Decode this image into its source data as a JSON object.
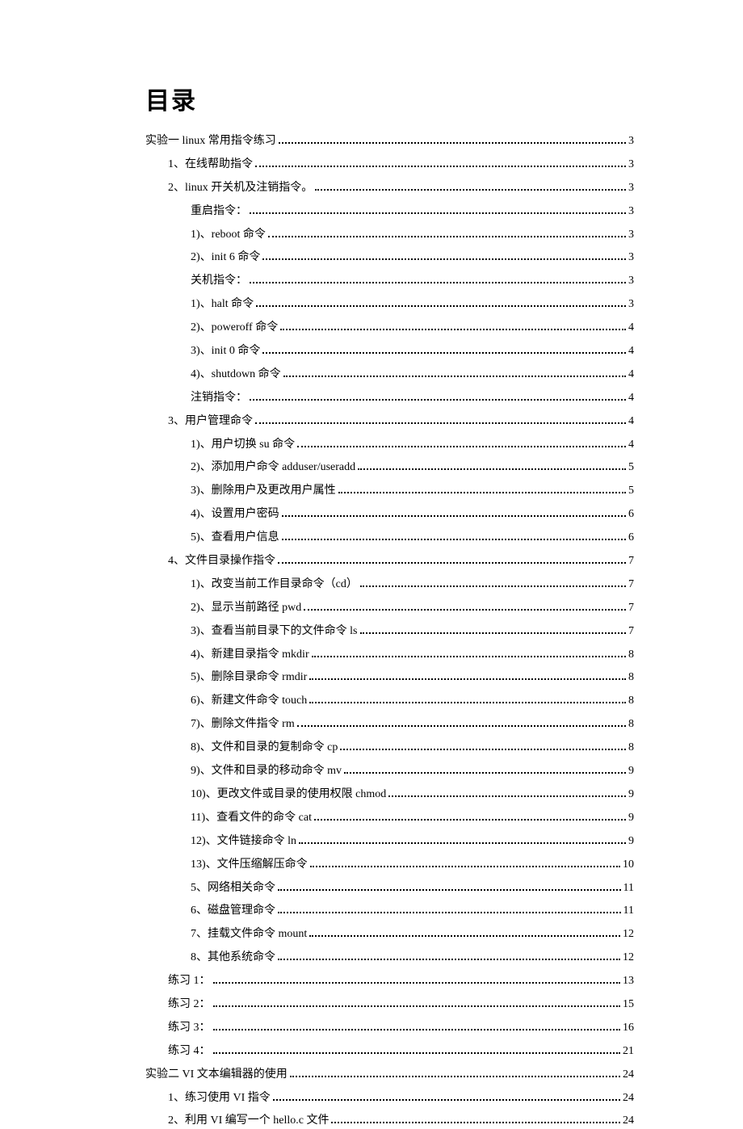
{
  "title": "目录",
  "entries": [
    {
      "level": 0,
      "label": "实验一  linux 常用指令练习",
      "page": "3"
    },
    {
      "level": 1,
      "label": "1、在线帮助指令",
      "page": "3"
    },
    {
      "level": 1,
      "label": "2、linux 开关机及注销指令。",
      "page": "3"
    },
    {
      "level": 2,
      "label": "重启指令：",
      "page": "3"
    },
    {
      "level": 2,
      "label": "1)、reboot 命令",
      "page": "3"
    },
    {
      "level": 2,
      "label": "2)、init 6 命令",
      "page": "3"
    },
    {
      "level": 2,
      "label": "关机指令：",
      "page": "3"
    },
    {
      "level": 2,
      "label": "1)、halt 命令",
      "page": "3"
    },
    {
      "level": 2,
      "label": "2)、poweroff 命令",
      "page": "4"
    },
    {
      "level": 2,
      "label": "3)、init 0 命令",
      "page": "4"
    },
    {
      "level": 2,
      "label": "4)、shutdown 命令",
      "page": "4"
    },
    {
      "level": 2,
      "label": "注销指令：",
      "page": "4"
    },
    {
      "level": 1,
      "label": "3、用户管理命令",
      "page": "4"
    },
    {
      "level": 2,
      "label": "1)、用户切换 su 命令",
      "page": "4"
    },
    {
      "level": 2,
      "label": "2)、添加用户命令 adduser/useradd",
      "page": "5"
    },
    {
      "level": 2,
      "label": "3)、删除用户及更改用户属性",
      "page": "5"
    },
    {
      "level": 2,
      "label": "4)、设置用户密码",
      "page": "6"
    },
    {
      "level": 2,
      "label": "5)、查看用户信息",
      "page": "6"
    },
    {
      "level": 1,
      "label": "4、文件目录操作指令",
      "page": "7"
    },
    {
      "level": 2,
      "label": "1)、改变当前工作目录命令（cd）",
      "page": "7"
    },
    {
      "level": 2,
      "label": "2)、显示当前路径 pwd",
      "page": "7"
    },
    {
      "level": 2,
      "label": "3)、查看当前目录下的文件命令 ls",
      "page": "7"
    },
    {
      "level": 2,
      "label": "4)、新建目录指令 mkdir",
      "page": "8"
    },
    {
      "level": 2,
      "label": "5)、删除目录命令 rmdir",
      "page": "8"
    },
    {
      "level": 2,
      "label": "6)、新建文件命令 touch",
      "page": "8"
    },
    {
      "level": 2,
      "label": "7)、删除文件指令 rm",
      "page": "8"
    },
    {
      "level": 2,
      "label": "8)、文件和目录的复制命令 cp",
      "page": "8"
    },
    {
      "level": 2,
      "label": "9)、文件和目录的移动命令 mv",
      "page": "9"
    },
    {
      "level": 2,
      "label": "10)、更改文件或目录的使用权限 chmod",
      "page": "9"
    },
    {
      "level": 2,
      "label": "11)、查看文件的命令 cat",
      "page": "9"
    },
    {
      "level": 2,
      "label": "12)、文件链接命令 ln",
      "page": "9"
    },
    {
      "level": 2,
      "label": "13)、文件压缩解压命令",
      "page": "10"
    },
    {
      "level": 2,
      "label": "5、网络相关命令",
      "page": "11"
    },
    {
      "level": 2,
      "label": "6、磁盘管理命令",
      "page": "11"
    },
    {
      "level": 2,
      "label": "7、挂载文件命令 mount",
      "page": "12"
    },
    {
      "level": 2,
      "label": "8、其他系统命令",
      "page": "12"
    },
    {
      "level": 1,
      "label": "练习 1：",
      "page": "13"
    },
    {
      "level": 1,
      "label": "练习 2：",
      "page": "15"
    },
    {
      "level": 1,
      "label": "练习 3：",
      "page": "16"
    },
    {
      "level": 1,
      "label": "练习 4：",
      "page": "21"
    },
    {
      "level": 0,
      "label": "实验二  VI 文本编辑器的使用",
      "page": "24"
    },
    {
      "level": 1,
      "label": "1、练习使用 VI 指令",
      "page": "24"
    },
    {
      "level": 1,
      "label": "2、利用 VI 编写一个 hello.c 文件",
      "page": "24"
    }
  ]
}
